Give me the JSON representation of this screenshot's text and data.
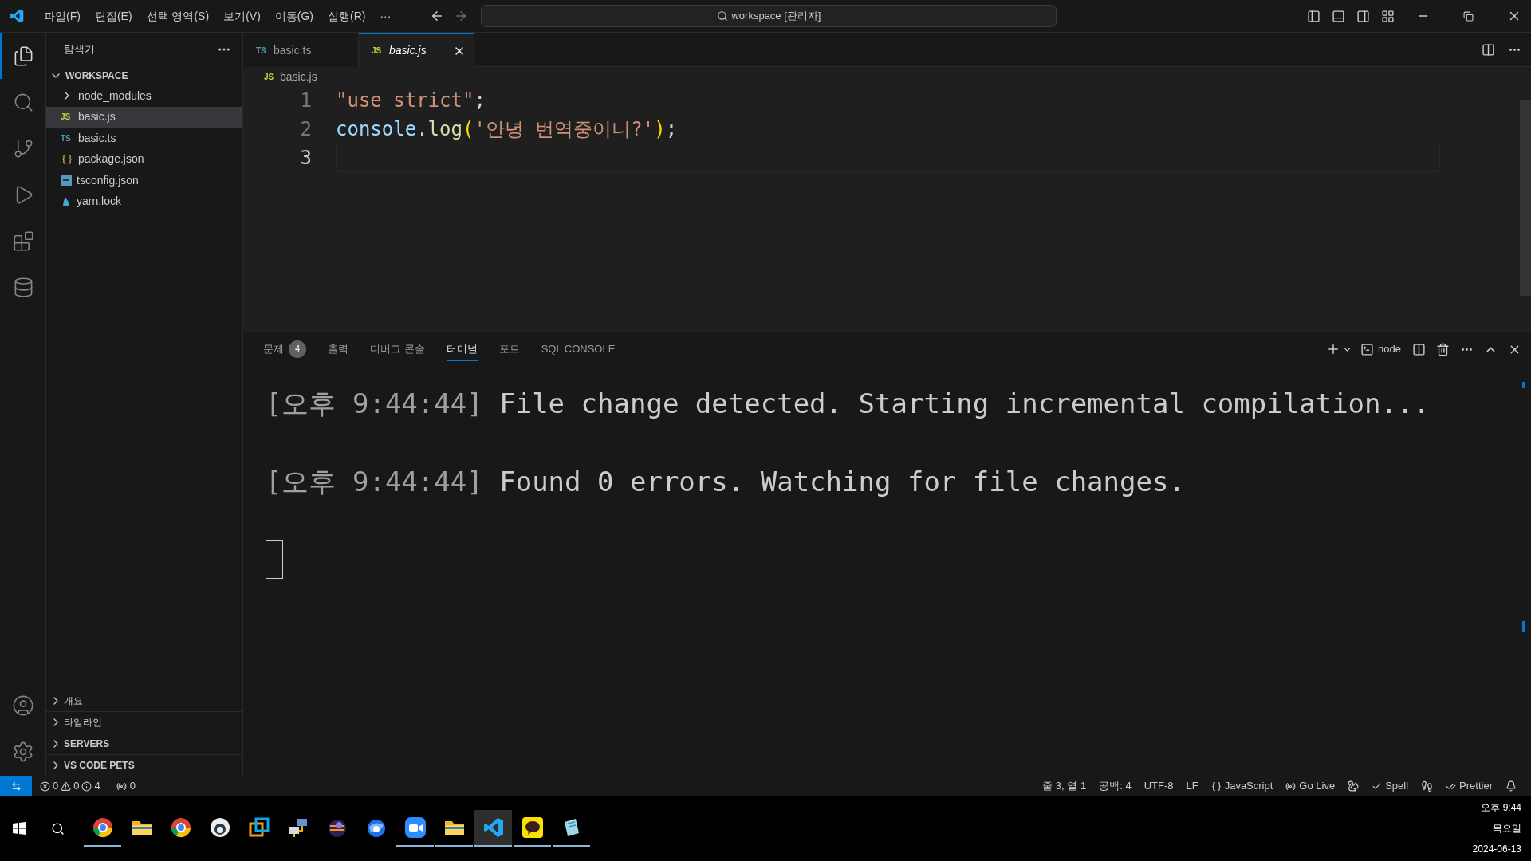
{
  "menu": [
    "파일(F)",
    "편집(E)",
    "선택 영역(S)",
    "보기(V)",
    "이동(G)",
    "실행(R)",
    "···"
  ],
  "command_center": {
    "title": "workspace [관리자]"
  },
  "activity_bar": [
    {
      "kind": "files",
      "selected": true
    },
    {
      "kind": "search",
      "selected": false
    },
    {
      "kind": "source-control",
      "selected": false
    },
    {
      "kind": "run",
      "selected": false
    },
    {
      "kind": "extensions",
      "selected": false
    },
    {
      "kind": "database",
      "selected": false
    }
  ],
  "explorer": {
    "title": "탐색기",
    "folder": "WORKSPACE",
    "expanded": true,
    "items": [
      {
        "name": "node_modules",
        "kind": "folder",
        "selected": false
      },
      {
        "name": "basic.js",
        "kind": "js",
        "icon": "JS",
        "selected": true
      },
      {
        "name": "basic.ts",
        "kind": "ts",
        "icon": "TS",
        "selected": false
      },
      {
        "name": "package.json",
        "kind": "json",
        "selected": false
      },
      {
        "name": "tsconfig.json",
        "kind": "tsconfig",
        "selected": false
      },
      {
        "name": "yarn.lock",
        "kind": "yarn",
        "selected": false
      }
    ],
    "sections": [
      {
        "label": "개요",
        "bold": false
      },
      {
        "label": "타임라인",
        "bold": false
      },
      {
        "label": "SERVERS",
        "bold": true
      },
      {
        "label": "VS CODE PETS",
        "bold": true
      }
    ]
  },
  "tabs": [
    {
      "label": "basic.ts",
      "kind": "ts",
      "icon": "TS",
      "selected": false
    },
    {
      "label": "basic.js",
      "kind": "js",
      "icon": "JS",
      "selected": true
    }
  ],
  "breadcrumb": {
    "label": "basic.js",
    "kind": "js",
    "icon": "JS"
  },
  "editor": {
    "lines": [
      {
        "number": "1",
        "current": false,
        "tokens": [
          {
            "text": "\"use strict\"",
            "kind": "string"
          },
          {
            "text": ";",
            "kind": "plain"
          }
        ]
      },
      {
        "number": "2",
        "current": false,
        "tokens": [
          {
            "text": "console",
            "kind": "variable"
          },
          {
            "text": ".",
            "kind": "plain"
          },
          {
            "text": "log",
            "kind": "function"
          },
          {
            "text": "(",
            "kind": "bracket"
          },
          {
            "text": "'안녕 번역중이니?'",
            "kind": "string"
          },
          {
            "text": ")",
            "kind": "bracket"
          },
          {
            "text": ";",
            "kind": "plain"
          }
        ]
      },
      {
        "number": "3",
        "current": true
      }
    ]
  },
  "panel": {
    "tabs": [
      {
        "label": "문제",
        "badge": "4",
        "selected": false
      },
      {
        "label": "출력",
        "selected": false
      },
      {
        "label": "디버그 콘솔",
        "selected": false
      },
      {
        "label": "터미널",
        "selected": true
      },
      {
        "label": "포트",
        "selected": false
      },
      {
        "label": "SQL CONSOLE",
        "selected": false
      }
    ],
    "terminal_name": "node",
    "terminal_lines": [
      {
        "time": "[오후 9:44:44]",
        "message": "File change detected. Starting incremental compilation..."
      },
      {
        "time": "[오후 9:44:44]",
        "message": "Found 0 errors. Watching for file changes."
      }
    ]
  },
  "status_bar": {
    "errors": "0",
    "warnings": "0",
    "infos": "4",
    "ports": "0",
    "right": [
      {
        "label": "줄 3, 열 1",
        "kind": "text"
      },
      {
        "label": "공백: 4",
        "kind": "text"
      },
      {
        "label": "UTF-8",
        "kind": "text"
      },
      {
        "label": "LF",
        "kind": "text"
      },
      {
        "label": "JavaScript",
        "kind": "braces"
      },
      {
        "label": "Go Live",
        "kind": "broadcast"
      },
      {
        "kind": "squirrel"
      },
      {
        "label": "Spell",
        "kind": "check"
      },
      {
        "kind": "shoe"
      },
      {
        "label": "Prettier",
        "kind": "double-check"
      },
      {
        "kind": "bell"
      }
    ]
  },
  "taskbar": {
    "apps": [
      {
        "kind": "browser",
        "running": true,
        "selected": false
      },
      {
        "kind": "folder",
        "running": false,
        "selected": false
      },
      {
        "kind": "browser",
        "running": false,
        "selected": false
      },
      {
        "kind": "round",
        "running": false,
        "selected": false
      },
      {
        "kind": "squares",
        "running": false,
        "selected": false
      },
      {
        "kind": "network",
        "running": false,
        "selected": false
      },
      {
        "kind": "orb",
        "running": false,
        "selected": false
      },
      {
        "kind": "bird",
        "running": false,
        "selected": false
      },
      {
        "kind": "camera",
        "running": true,
        "selected": false
      },
      {
        "kind": "folder",
        "running": true,
        "selected": false
      },
      {
        "kind": "code",
        "running": true,
        "selected": true
      },
      {
        "kind": "chat",
        "running": true,
        "selected": false
      },
      {
        "kind": "notes",
        "running": true,
        "selected": false
      }
    ],
    "time": "오후 9:44",
    "weekday": "목요일",
    "date": "2024-06-13"
  }
}
